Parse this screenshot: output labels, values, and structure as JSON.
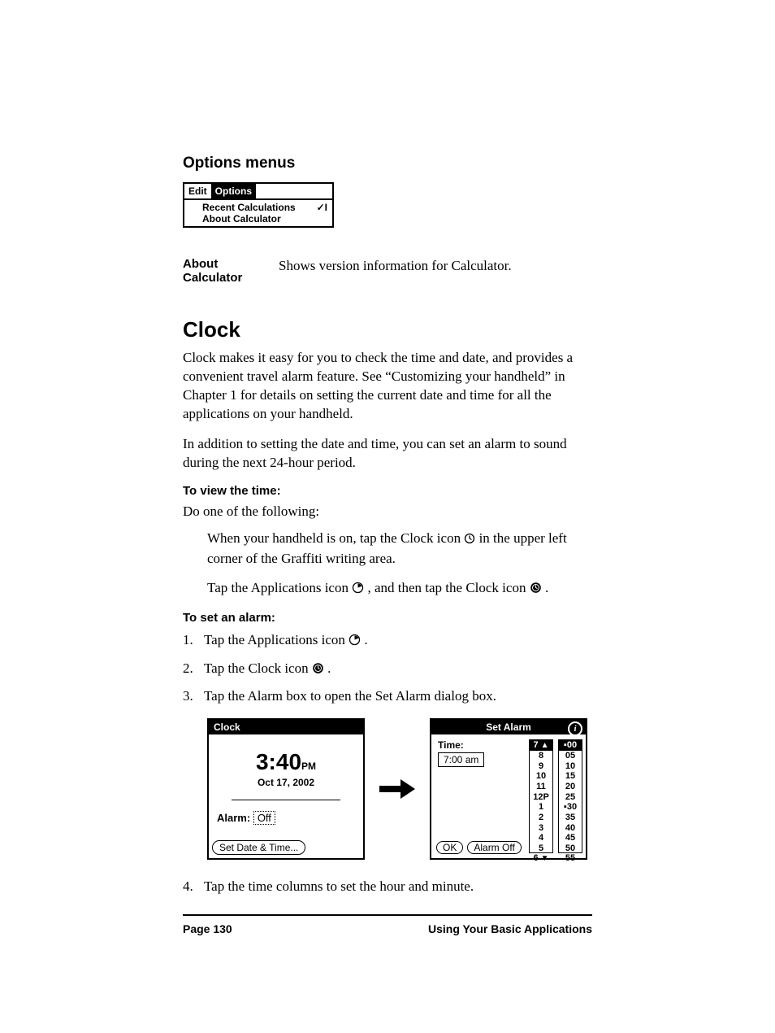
{
  "headings": {
    "options_menus": "Options menus",
    "clock": "Clock"
  },
  "options_menu": {
    "tab_edit": "Edit",
    "tab_options": "Options",
    "item_recent": "Recent Calculations",
    "item_recent_shortcut": "✓I",
    "item_about": "About Calculator"
  },
  "about_row": {
    "label": "About Calculator",
    "desc": "Shows version information for Calculator."
  },
  "clock_intro_1": "Clock makes it easy for you to check the time and date, and provides a convenient travel alarm feature. See “Customizing your handheld” in Chapter 1 for details on setting the current date and time for all the applications on your handheld.",
  "clock_intro_2": "In addition to setting the date and time, you can set an alarm to sound during the next 24-hour period.",
  "to_view_time": "To view the time:",
  "do_one": "Do one of the following:",
  "view_bullet_1a": "When your handheld is on, tap the Clock icon ",
  "view_bullet_1b": " in the upper left corner of the Graffiti writing area.",
  "view_bullet_2a": "Tap the Applications icon ",
  "view_bullet_2b": ", and then tap the Clock icon ",
  "view_bullet_2c": ".",
  "to_set_alarm": "To set an alarm:",
  "steps": {
    "s1a": "Tap the Applications icon ",
    "s1b": ".",
    "s2a": "Tap the Clock icon ",
    "s2b": ".",
    "s3": "Tap the Alarm box to open the Set Alarm dialog box.",
    "s4": "Tap the time columns to set the hour and minute."
  },
  "clock_shot": {
    "title": "Clock",
    "time": "3:40",
    "ampm": "PM",
    "date": "Oct 17, 2002",
    "alarm_label": "Alarm:",
    "alarm_value": "Off",
    "button": "Set Date & Time..."
  },
  "alarm_shot": {
    "title": "Set Alarm",
    "time_label": "Time:",
    "time_value": "7:00 am",
    "hours": [
      "7",
      "8",
      "9",
      "10",
      "11",
      "12P",
      "1",
      "2",
      "3",
      "4",
      "5",
      "6"
    ],
    "hours_sel_index": 0,
    "minutes": [
      "00",
      "05",
      "10",
      "15",
      "20",
      "25",
      "30",
      "35",
      "40",
      "45",
      "50",
      "55"
    ],
    "minutes_marker_index": 0,
    "btn_ok": "OK",
    "btn_off": "Alarm Off"
  },
  "footer": {
    "left": "Page 130",
    "right": "Using Your Basic Applications"
  }
}
